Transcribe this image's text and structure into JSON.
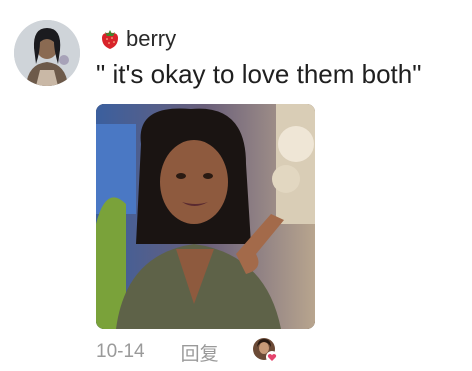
{
  "comment": {
    "username": "berry",
    "username_emoji_icon": "strawberry-icon",
    "text": "\" it's okay to love them both\"",
    "date": "10-14",
    "reply_label": "回复"
  },
  "icons": {
    "avatar": "avatar",
    "media": "gif-image",
    "liker": "liker-avatar-with-heart-icon"
  },
  "colors": {
    "text_primary": "#1f1f1f",
    "meta_text": "#9a9a9a",
    "heart": "#e5446d"
  }
}
